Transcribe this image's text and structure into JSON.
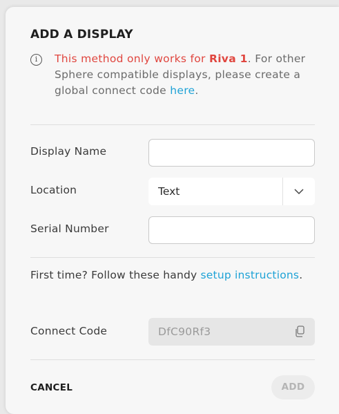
{
  "dialog": {
    "title": "ADD A DISPLAY",
    "info": {
      "icon": "info-icon",
      "prefix": "This method only works for ",
      "device": "Riva 1",
      "middle": ". For other Sphere compatible displays, please create a global connect code ",
      "link": "here",
      "suffix": "."
    },
    "fields": {
      "display_name_label": "Display Name",
      "display_name_value": "",
      "location_label": "Location",
      "location_value": "Text",
      "serial_label": "Serial Number",
      "serial_value": ""
    },
    "setup": {
      "text": "First time? Follow these handy ",
      "link": "setup instructions",
      "suffix": "."
    },
    "connect": {
      "label": "Connect Code",
      "value": "DfC90Rf3",
      "copy_icon": "copy-icon"
    },
    "actions": {
      "cancel": "CANCEL",
      "add": "ADD"
    },
    "colors": {
      "warning": "#e0463f",
      "link": "#1ea2d6",
      "background": "#f7f7f7"
    }
  }
}
